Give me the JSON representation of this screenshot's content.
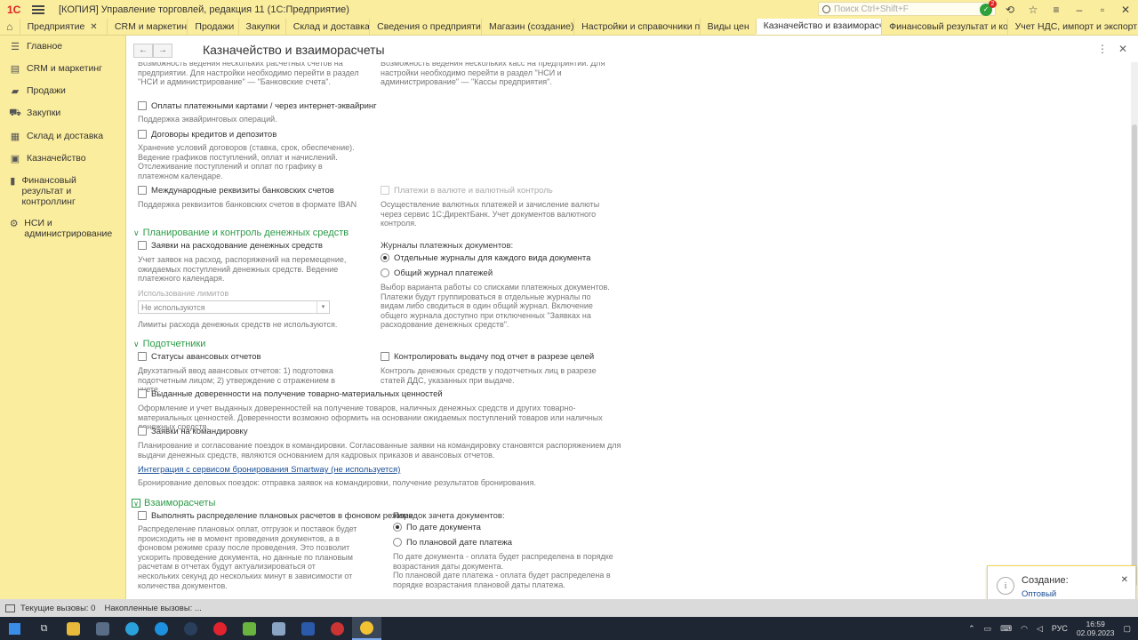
{
  "app": {
    "logo": "1С",
    "title": "[КОПИЯ] Управление торговлей, редакция 11  (1С:Предприятие)",
    "search_placeholder": "Поиск Ctrl+Shift+F",
    "notif_count": "2"
  },
  "tabs": [
    {
      "label": "Предприятие"
    },
    {
      "label": "CRM и маркетинг"
    },
    {
      "label": "Продажи"
    },
    {
      "label": "Закупки"
    },
    {
      "label": "Склад и доставка"
    },
    {
      "label": "Сведения о предприятии"
    },
    {
      "label": "Магазин (создание) *"
    },
    {
      "label": "Настройки и справочники п..."
    },
    {
      "label": "Виды цен"
    },
    {
      "label": "Казначейство и взаиморасч..."
    },
    {
      "label": "Финансовый результат и ко..."
    },
    {
      "label": "Учет НДС, импорт и экспорт"
    }
  ],
  "sidebar": {
    "items": [
      {
        "label": "Главное",
        "icon": "menu-icon"
      },
      {
        "label": "CRM и маркетинг",
        "icon": "crm-icon"
      },
      {
        "label": "Продажи",
        "icon": "sales-icon"
      },
      {
        "label": "Закупки",
        "icon": "cart-icon"
      },
      {
        "label": "Склад и доставка",
        "icon": "warehouse-icon"
      },
      {
        "label": "Казначейство",
        "icon": "treasury-icon"
      },
      {
        "label": "Финансовый результат и контроллинг",
        "icon": "chart-icon"
      },
      {
        "label": "НСИ и администрирование",
        "icon": "gear-icon"
      }
    ]
  },
  "page": {
    "title": "Казначейство и взаиморасчеты",
    "back": "←",
    "forward": "→"
  },
  "top": {
    "left_note": "Возможность ведения нескольких расчетных счетов на предприятии. Для настройки необходимо перейти в раздел \"НСИ и администрирование\" — \"Банковские счета\".",
    "right_note": "Возможность ведения нескольких касс на предприятии. Для настройки необходимо перейти в раздел \"НСИ и администрирование\" — \"Кассы предприятия\"."
  },
  "payments_cards": {
    "label": "Оплаты платежными картами / через интернет-эквайринг",
    "note": "Поддержка эквайринговых операций."
  },
  "loans": {
    "label": "Договоры кредитов и депозитов",
    "note": "Хранение условий договоров (ставка, срок, обеспечение). Ведение графиков поступлений, оплат и начислений. Отслеживание поступлений и оплат по графику в платежном календаре."
  },
  "intl_bank": {
    "label": "Международные реквизиты банковских счетов",
    "note": "Поддержка реквизитов банковских счетов в формате IBAN"
  },
  "currency": {
    "label": "Платежи в валюте и валютный контроль",
    "note": "Осуществление валютных платежей и зачисление валюты через сервис 1С:ДиректБанк. Учет документов валютного контроля."
  },
  "planning": {
    "header": "Планирование и контроль денежных средств",
    "requests_label": "Заявки на расходование денежных средств",
    "requests_note": "Учет заявок на расход, распоряжений на перемещение, ожидаемых поступлений денежных средств. Ведение платежного календаря.",
    "limits_label": "Использование лимитов",
    "limits_value": "Не используются",
    "limits_note": "Лимиты расхода денежных средств не используются.",
    "journals_label": "Журналы платежных документов:",
    "journal_opt1": "Отдельные журналы для каждого вида документа",
    "journal_opt2": "Общий журнал платежей",
    "journals_note": "Выбор варианта работы со списками платежных документов. Платежи будут группироваться в отдельные журналы по видам либо сводиться в один общий журнал. Включение общего журнала доступно при отключенных \"Заявках на расходование денежных средств\"."
  },
  "accountable": {
    "header": "Подотчетники",
    "statuses_label": "Статусы авансовых отчетов",
    "statuses_note": "Двухэтапный ввод авансовых отчетов: 1) подготовка подотчетным лицом; 2) утверждение с отражением в учете.",
    "control_label": "Контролировать выдачу под отчет в разрезе целей",
    "control_note": "Контроль денежных средств у подотчетных лиц в разрезе статей ДДС, указанных при выдаче.",
    "poa_label": "Выданные доверенности на получение товарно-материальных ценностей",
    "poa_note": "Оформление и учет выданных доверенностей на получение товаров, наличных денежных средств и других товарно-материальных ценностей. Доверенности возможно оформить на основании ожидаемых поступлений товаров или наличных денежных средств.",
    "trip_label": "Заявки на командировку",
    "trip_note": "Планирование и согласование поездок в командировки. Согласованные заявки на командировку становятся распоряжением для выдачи денежных средств, являются основанием для кадровых приказов и авансовых отчетов.",
    "smartway_link": "Интеграция с сервисом бронирования Smartway (не используется)",
    "smartway_note": "Бронирование деловых поездок: отправка заявок на командировки, получение результатов бронирования."
  },
  "settlements": {
    "header": "Взаиморасчеты",
    "bg_label": "Выполнять распределение плановых расчетов в фоновом режиме",
    "bg_note": "Распределение плановых оплат, отгрузок и поставок будет происходить не в момент проведения документов, а в фоновом режиме сразу после проведения. Это позволит ускорить проведение документа, но данные по плановым расчетам в отчетах будут актуализироваться от нескольких секунд до нескольких минут в зависимости от количества документов.",
    "order_label": "Порядок зачета документов:",
    "order_opt1": "По дате документа",
    "order_opt2": "По плановой дате платежа",
    "order_note1": "По дате документа - оплата будет распределена в порядке возрастания даты документа.",
    "order_note2": "По плановой дате платежа - оплата будет распределена в порядке возрастания плановой даты платежа."
  },
  "toast": {
    "title": "Создание:",
    "link": "Оптовый"
  },
  "status": {
    "current_calls": "Текущие вызовы:  0",
    "accumulated_calls": "Накопленные вызовы:  ..."
  },
  "taskbar": {
    "lang": "РУС",
    "time": "16:59",
    "date": "02.09.2023"
  }
}
